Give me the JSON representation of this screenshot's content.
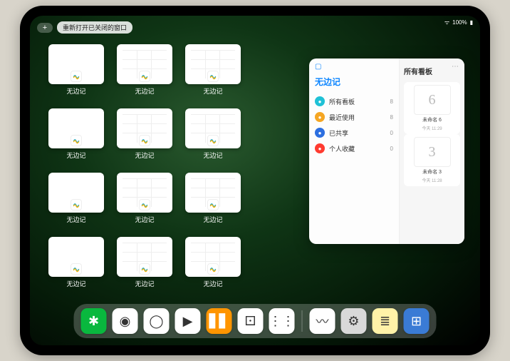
{
  "status": {
    "signal": "▂▃▅",
    "battery": "100%"
  },
  "topbar": {
    "reopen_label": "重新打开已关闭的窗口"
  },
  "app_name": "无边记",
  "windows": [
    {
      "label": "无边记",
      "variant": "blank"
    },
    {
      "label": "无边记",
      "variant": "cal"
    },
    {
      "label": "无边记",
      "variant": "cal"
    },
    {
      "label": "无边记",
      "variant": "blank"
    },
    {
      "label": "无边记",
      "variant": "cal"
    },
    {
      "label": "无边记",
      "variant": "cal"
    },
    {
      "label": "无边记",
      "variant": "blank"
    },
    {
      "label": "无边记",
      "variant": "cal"
    },
    {
      "label": "无边记",
      "variant": "cal"
    },
    {
      "label": "无边记",
      "variant": "blank"
    },
    {
      "label": "无边记",
      "variant": "cal"
    },
    {
      "label": "无边记",
      "variant": "cal"
    }
  ],
  "panel": {
    "title": "无边记",
    "right_title": "所有看板",
    "items": [
      {
        "icon": "grid",
        "color": "#1fc1d6",
        "label": "所有看板",
        "count": "8"
      },
      {
        "icon": "clock",
        "color": "#f5a623",
        "label": "最近使用",
        "count": "8"
      },
      {
        "icon": "share",
        "color": "#2d6fe0",
        "label": "已共享",
        "count": "0"
      },
      {
        "icon": "heart",
        "color": "#ff3b30",
        "label": "个人收藏",
        "count": "0"
      }
    ],
    "boards": [
      {
        "sketch": "6",
        "name": "未命名 6",
        "time": "今天 11:29"
      },
      {
        "sketch": "3",
        "name": "未命名 3",
        "time": "今天 11:28"
      }
    ]
  },
  "dock": [
    {
      "name": "wechat",
      "bg": "#09b83e",
      "glyph": "✱"
    },
    {
      "name": "quark",
      "bg": "#ffffff",
      "glyph": "◉"
    },
    {
      "name": "qqbrowser",
      "bg": "#ffffff",
      "glyph": "◯"
    },
    {
      "name": "play",
      "bg": "#ffffff",
      "glyph": "▶"
    },
    {
      "name": "books",
      "bg": "#ff9500",
      "glyph": "▋▋"
    },
    {
      "name": "dice",
      "bg": "#ffffff",
      "glyph": "⚀"
    },
    {
      "name": "nodes",
      "bg": "#ffffff",
      "glyph": "⋮⋮"
    },
    {
      "name": "freeform",
      "bg": "#ffffff",
      "glyph": "〰"
    },
    {
      "name": "settings",
      "bg": "#d9d9d9",
      "glyph": "⚙"
    },
    {
      "name": "notes",
      "bg": "#fff2a8",
      "glyph": "≣"
    },
    {
      "name": "apps",
      "bg": "#3a7bd5",
      "glyph": "⊞"
    }
  ]
}
